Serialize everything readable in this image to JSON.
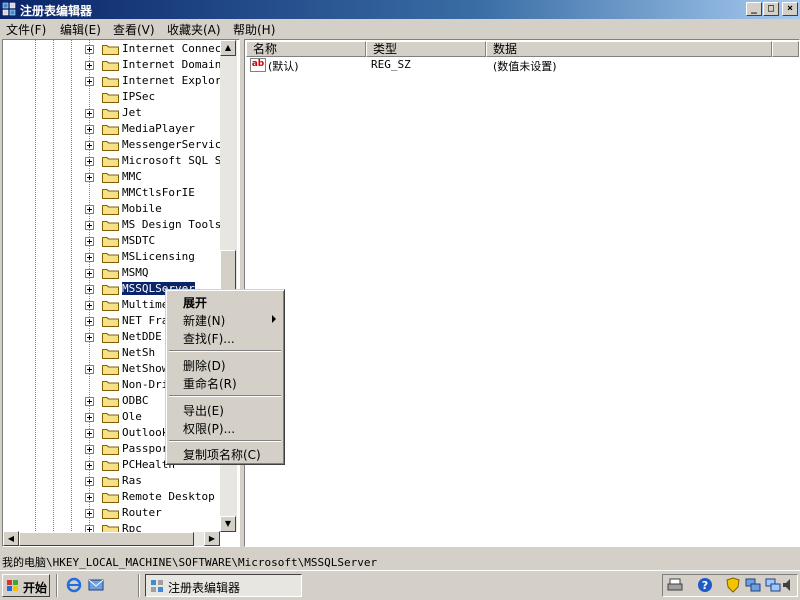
{
  "window": {
    "title": "注册表编辑器",
    "controls": {
      "minimize": "_",
      "maximize": "□",
      "close": "×"
    }
  },
  "menu": [
    "文件(F)",
    "编辑(E)",
    "查看(V)",
    "收藏夹(A)",
    "帮助(H)"
  ],
  "tree": {
    "items": [
      {
        "label": "Internet Connecti",
        "expandable": true
      },
      {
        "label": "Internet Domains",
        "expandable": true
      },
      {
        "label": "Internet Explorer",
        "expandable": true
      },
      {
        "label": "IPSec",
        "expandable": false
      },
      {
        "label": "Jet",
        "expandable": true
      },
      {
        "label": "MediaPlayer",
        "expandable": true
      },
      {
        "label": "MessengerService",
        "expandable": true
      },
      {
        "label": "Microsoft SQL Ser",
        "expandable": true
      },
      {
        "label": "MMC",
        "expandable": true
      },
      {
        "label": "MMCtlsForIE",
        "expandable": false
      },
      {
        "label": "Mobile",
        "expandable": true
      },
      {
        "label": "MS Design Tools",
        "expandable": true
      },
      {
        "label": "MSDTC",
        "expandable": true
      },
      {
        "label": "MSLicensing",
        "expandable": true
      },
      {
        "label": "MSMQ",
        "expandable": true
      },
      {
        "label": "MSSQLServer",
        "expandable": true,
        "selected": true
      },
      {
        "label": "Multime",
        "expandable": true
      },
      {
        "label": "NET Fra",
        "expandable": true
      },
      {
        "label": "NetDDE",
        "expandable": true
      },
      {
        "label": "NetSh",
        "expandable": false
      },
      {
        "label": "NetShow",
        "expandable": true
      },
      {
        "label": "Non-Dri",
        "expandable": false
      },
      {
        "label": "ODBC",
        "expandable": true
      },
      {
        "label": "Ole",
        "expandable": true
      },
      {
        "label": "Outlook",
        "expandable": true
      },
      {
        "label": "Passpor",
        "expandable": true
      },
      {
        "label": "PCHealth",
        "expandable": true
      },
      {
        "label": "Ras",
        "expandable": true
      },
      {
        "label": "Remote Desktop",
        "expandable": true
      },
      {
        "label": "Router",
        "expandable": true
      },
      {
        "label": "Rpc",
        "expandable": true
      }
    ]
  },
  "list": {
    "columns": [
      "名称",
      "类型",
      "数据"
    ],
    "rows": [
      {
        "name": "(默认)",
        "type": "REG_SZ",
        "data": "(数值未设置)"
      }
    ]
  },
  "context_menu": {
    "expand": "展开",
    "new": "新建(N)",
    "find": "查找(F)...",
    "delete": "删除(D)",
    "rename": "重命名(R)",
    "export": "导出(E)",
    "permissions": "权限(P)...",
    "copy_key_name": "复制项名称(C)"
  },
  "status": {
    "path": "我的电脑\\HKEY_LOCAL_MACHINE\\SOFTWARE\\Microsoft\\MSSQLServer"
  },
  "taskbar": {
    "start": "开始",
    "task": "注册表编辑器"
  },
  "icons": {
    "app": "registry-editor-icon",
    "folder": "folder-icon",
    "string_value": "string-value-icon",
    "start": "windows-flag-icon",
    "ie": "internet-explorer-icon",
    "outlook": "outlook-express-icon",
    "printer": "printer-icon",
    "help": "help-icon",
    "shield": "security-shield-icon",
    "network": "network-icon",
    "volume": "volume-icon"
  },
  "colors": {
    "title_start": "#0a246a",
    "title_end": "#a6caf0",
    "selection": "#0a246a",
    "face": "#d4d0c8"
  }
}
